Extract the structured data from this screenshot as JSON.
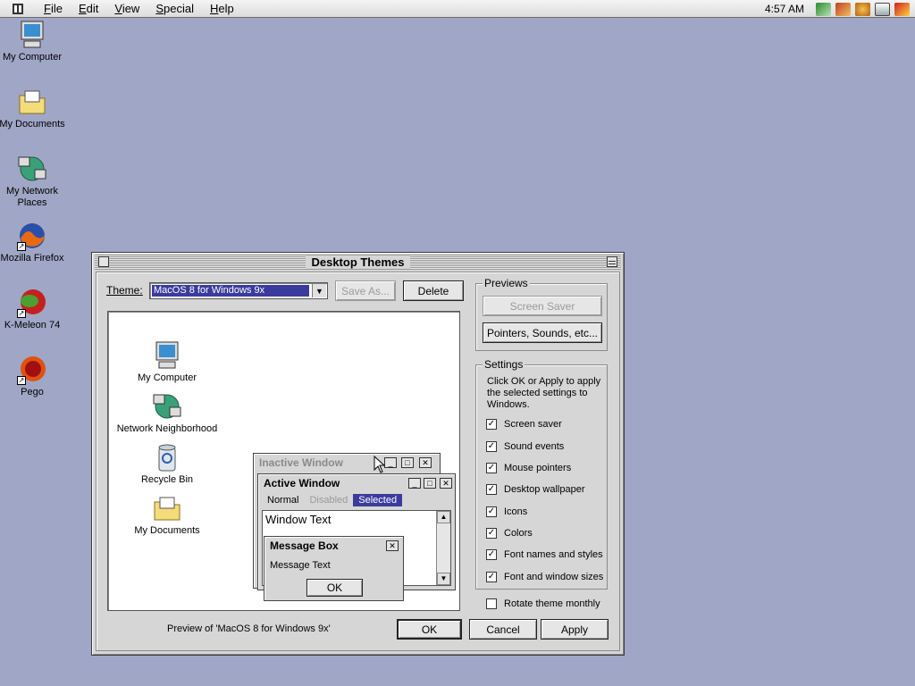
{
  "menubar": {
    "items": [
      {
        "label": "File",
        "u": "F",
        "rest": "ile"
      },
      {
        "label": "Edit",
        "u": "E",
        "rest": "dit"
      },
      {
        "label": "View",
        "u": "V",
        "rest": "iew"
      },
      {
        "label": "Special",
        "u": "S",
        "rest": "pecial"
      },
      {
        "label": "Help",
        "u": "H",
        "rest": "elp"
      }
    ],
    "clock": "4:57 AM"
  },
  "desktop": {
    "icons": [
      {
        "label": "My Computer"
      },
      {
        "label": "My Documents"
      },
      {
        "label": "My Network Places"
      },
      {
        "label": "Mozilla Firefox"
      },
      {
        "label": "K-Meleon 74"
      },
      {
        "label": "Pego"
      }
    ]
  },
  "dialog": {
    "title": "Desktop Themes",
    "theme_label": "Theme:",
    "theme_value": "MacOS 8 for Windows 9x",
    "save_as": "Save As...",
    "delete": "Delete",
    "preview_caption": "Preview of 'MacOS 8 for Windows 9x'",
    "ok": "OK",
    "cancel": "Cancel",
    "apply": "Apply",
    "previews": {
      "title": "Previews",
      "screen_saver": "Screen Saver",
      "pointers": "Pointers, Sounds, etc..."
    },
    "settings": {
      "title": "Settings",
      "description": "Click OK or Apply to apply the selected settings to Windows.",
      "items": [
        {
          "label": "Screen saver",
          "checked": true
        },
        {
          "label": "Sound events",
          "checked": true
        },
        {
          "label": "Mouse pointers",
          "checked": true
        },
        {
          "label": "Desktop wallpaper",
          "checked": true
        },
        {
          "label": "Icons",
          "checked": true
        },
        {
          "label": "Colors",
          "checked": true
        },
        {
          "label": "Font names and styles",
          "checked": true
        },
        {
          "label": "Font and window sizes",
          "checked": true
        }
      ]
    },
    "rotate": {
      "label": "Rotate theme monthly",
      "checked": false
    }
  },
  "preview": {
    "icons": [
      {
        "label": "My Computer"
      },
      {
        "label": "Network Neighborhood"
      },
      {
        "label": "Recycle Bin"
      },
      {
        "label": "My Documents"
      }
    ],
    "inactive_window": "Inactive Window",
    "active_window": "Active Window",
    "menu_normal": "Normal",
    "menu_disabled": "Disabled",
    "menu_selected": "Selected",
    "window_text": "Window Text",
    "message_box": "Message Box",
    "message_text": "Message Text",
    "message_ok": "OK"
  }
}
